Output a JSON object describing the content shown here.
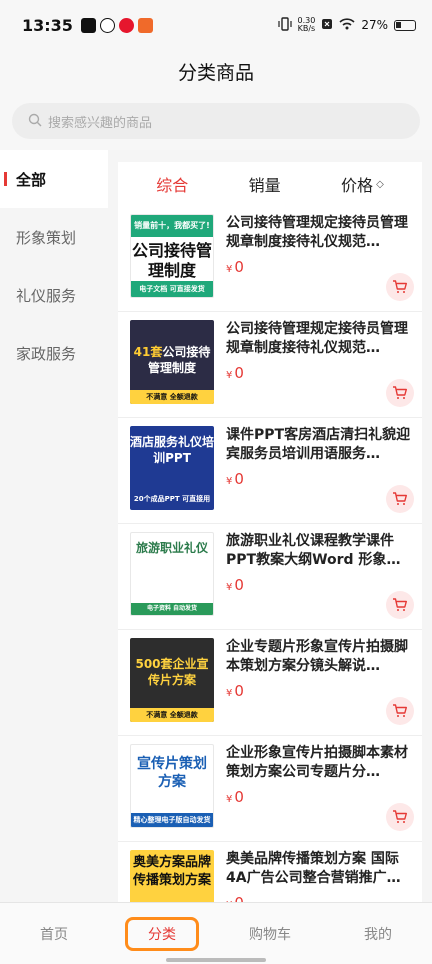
{
  "status_bar": {
    "time": "13:35",
    "net_speed_value": "0.30",
    "net_speed_unit": "KB/s",
    "battery": "27%"
  },
  "header": {
    "title": "分类商品"
  },
  "search": {
    "placeholder": "搜索感兴趣的商品"
  },
  "sidebar": {
    "items": [
      {
        "label": "全部",
        "active": true
      },
      {
        "label": "形象策划",
        "active": false
      },
      {
        "label": "礼仪服务",
        "active": false
      },
      {
        "label": "家政服务",
        "active": false
      }
    ]
  },
  "sort_bar": {
    "items": [
      {
        "label": "综合",
        "active": true
      },
      {
        "label": "销量",
        "active": false
      },
      {
        "label": "价格",
        "active": false
      }
    ],
    "price_caret": "◇"
  },
  "currency_symbol": "¥",
  "products": [
    {
      "title": "公司接待管理规定接待员管理规章制度接待礼仪规范…",
      "price": "0",
      "thumb": {
        "top": "销量前十，我都买了!",
        "big": "公司接待管理制度",
        "foot": "电子文档 可直接发货"
      }
    },
    {
      "title": "公司接待管理规定接待员管理规章制度接待礼仪规范…",
      "price": "0",
      "thumb": {
        "big_hl": "41套",
        "big": "公司接待管理制度",
        "foot": "不满意 全额退款"
      }
    },
    {
      "title": "课件PPT客房酒店清扫礼貌迎宾服务员培训用语服务…",
      "price": "0",
      "thumb": {
        "big": "酒店服务礼仪培训PPT",
        "foot": "20个成品PPT 可直接用"
      }
    },
    {
      "title": "旅游职业礼仪课程教学课件PPT教案大纲Word 形象社…",
      "price": "0",
      "thumb": {
        "big": "旅游职业礼仪",
        "foot": "电子资料 自动发货"
      }
    },
    {
      "title": "企业专题片形象宣传片拍摄脚本策划方案分镜头解说…",
      "price": "0",
      "thumb": {
        "big": "500套企业宣传片方案",
        "foot": "不满意 全额退款"
      }
    },
    {
      "title": "企业形象宣传片拍摄脚本素材策划方案公司专题片分…",
      "price": "0",
      "thumb": {
        "big": "宣传片策划方案",
        "foot": "精心整理电子版自动发货"
      }
    },
    {
      "title": "奥美品牌传播策划方案 国际4A广告公司整合营销推广…",
      "price": "0",
      "thumb": {
        "big": "奥美方案品牌传播策划方案"
      }
    }
  ],
  "bottom_nav": {
    "items": [
      {
        "label": "首页",
        "active": false
      },
      {
        "label": "分类",
        "active": true
      },
      {
        "label": "购物车",
        "active": false
      },
      {
        "label": "我的",
        "active": false
      }
    ]
  },
  "colors": {
    "accent": "#e53935",
    "highlight_box": "#ff8c1a"
  }
}
